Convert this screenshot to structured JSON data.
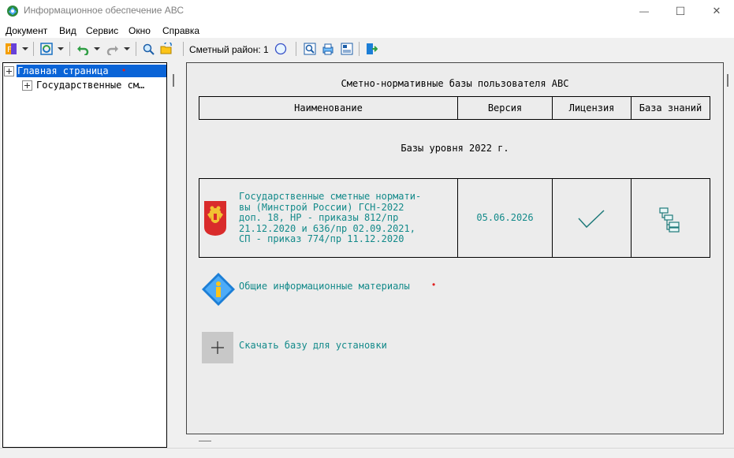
{
  "window": {
    "title": "Информационное обеспечение АВС",
    "minimize": "—",
    "maximize": "☐",
    "close": "✕"
  },
  "menu": [
    "Документ",
    "Вид",
    "Сервис",
    "Окно",
    "Справка"
  ],
  "toolbar": {
    "smetny_label": "Сметный район: 1",
    "icons": [
      "format-icon",
      "refresh-icon",
      "undo-icon",
      "redo-icon",
      "search-icon",
      "open-folder-icon",
      "zoom-icon",
      "print-icon",
      "export-icon",
      "settings-icon",
      "exit-icon"
    ]
  },
  "tree": {
    "items": [
      {
        "label": "Главная страница",
        "selected": true,
        "marker": "•"
      },
      {
        "label": "Государственные см…"
      }
    ]
  },
  "content": {
    "heading": "Сметно-нормативные базы пользователя АВС",
    "columns": [
      "Наименование",
      "Версия",
      "Лицензия",
      "База знаний"
    ],
    "section_title": "Базы уровня 2022 г.",
    "row": {
      "name_lines": [
        "Государственные сметные нормати-",
        "вы (Минстрой России) ГСН-2022",
        "доп. 18, НР - приказы 812/пр",
        "21.12.2020 и 636/пр 02.09.2021,",
        "СП - приказ 774/пр 11.12.2020"
      ],
      "version": "05.06.2026",
      "license_icon": "checkmark-icon",
      "knowledge_icon": "tree-structure-icon"
    },
    "info_link": "Общие информационные материалы",
    "info_marker": "•",
    "download_link": "Скачать базу для установки"
  },
  "colors": {
    "link": "#138a8a",
    "selection": "#0a64d7",
    "marker": "#e02020"
  }
}
